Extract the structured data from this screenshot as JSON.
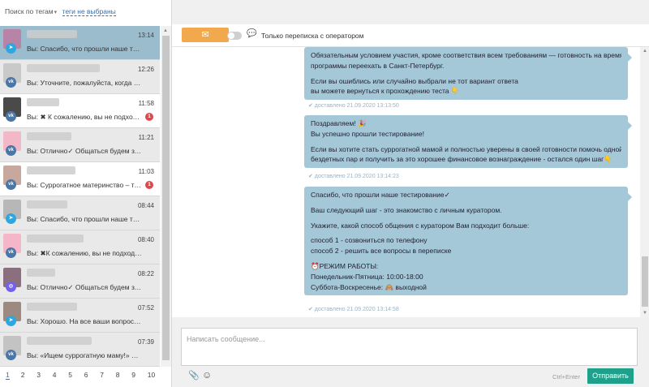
{
  "filter": {
    "label": "Поиск по тегам",
    "caret": "▾",
    "tags_link": "теги не выбраны"
  },
  "conversations": [
    {
      "time": "13:14",
      "preview": "Вы: Спасибо, что прошли наше тестов...",
      "network": "tg",
      "net_glyph": "➤",
      "state": "active",
      "avatar_color": "#b784a7",
      "badge": ""
    },
    {
      "time": "12:26",
      "preview": "Вы: Уточните, пожалуйста, когда ва...",
      "network": "vk",
      "net_glyph": "vk",
      "state": "normal",
      "avatar_color": "#c9c9c9",
      "badge": ""
    },
    {
      "time": "11:58",
      "preview": "Вы: ✖ К сожалению, вы не подходите...",
      "network": "vk",
      "net_glyph": "vk",
      "state": "white",
      "avatar_color": "#4a4a4a",
      "badge": "1"
    },
    {
      "time": "11:21",
      "preview": "Вы: Отлично✓ Общаться будем здес...",
      "network": "vk",
      "net_glyph": "vk",
      "state": "normal",
      "avatar_color": "#f2b8c8",
      "badge": ""
    },
    {
      "time": "11:03",
      "preview": "Вы: Суррогатное материнство – тяж...",
      "network": "vk",
      "net_glyph": "vk",
      "state": "white",
      "avatar_color": "#c8a89c",
      "badge": "1"
    },
    {
      "time": "08:44",
      "preview": "Вы: Спасибо, что прошли наше тест...",
      "network": "tg",
      "net_glyph": "➤",
      "state": "normal",
      "avatar_color": "#b7b7b7",
      "badge": ""
    },
    {
      "time": "08:40",
      "preview": "Вы: ✖К сожалению, вы не подходите...",
      "network": "vk",
      "net_glyph": "vk",
      "state": "normal",
      "avatar_color": "#f4b6c8",
      "badge": ""
    },
    {
      "time": "08:22",
      "preview": "Вы: Отлично✓ Общаться будем здес...",
      "network": "vb",
      "net_glyph": "◎",
      "state": "normal",
      "avatar_color": "#8a6f7e",
      "badge": ""
    },
    {
      "time": "07:52",
      "preview": "Вы: Хорошо. На все ваши вопросы п...",
      "network": "tg",
      "net_glyph": "➤",
      "state": "normal",
      "avatar_color": "#9c8a80",
      "badge": ""
    },
    {
      "time": "07:39",
      "preview": "Вы: «Ищем суррогатную маму!» Если...",
      "network": "vk",
      "net_glyph": "vk",
      "state": "normal",
      "avatar_color": "#c3c3c3",
      "badge": ""
    }
  ],
  "pagination": [
    "1",
    "2",
    "3",
    "4",
    "5",
    "6",
    "7",
    "8",
    "9",
    "10"
  ],
  "topbar": {
    "mail_icon": "✉",
    "toggle_label": "Только переписка с оператором",
    "chat_icon": "💬"
  },
  "messages": [
    {
      "lines": [
        "Обязательным условием участия, кроме соответствия всем требованиям — готовность на время",
        "программы переехать в Санкт-Петербург.",
        "",
        "Если вы ошиблись или случайно выбрали не тот вариант ответа",
        "вы можете вернуться к прохождению теста 👇"
      ],
      "status": "✔ доставлено 21.09.2020 13:13:50"
    },
    {
      "lines": [
        "Поздравляем! 🎉",
        "Вы успешно прошли тестирование!",
        "",
        "Если вы хотите стать суррогатной мамой и полностью уверены в своей готовности помочь одной из",
        "бездетных пар и получить за это хорошее финансовое вознаграждение - остался один шаг👇"
      ],
      "status": "✔ доставлено 21.09.2020 13:14:23"
    },
    {
      "lines": [
        "Спасибо, что прошли наше тестирование✓",
        "",
        "Ваш следующий шаг - это знакомство с личным куратором.",
        "",
        "Укажите, какой способ общения с куратором Вам подходит больше:",
        "",
        "способ 1 - созвониться по телефону",
        "способ 2 - решить все вопросы в переписке",
        "",
        "⏰РЕЖИМ РАБОТЫ:",
        "Понедельник-Пятница: 10:00-18:00",
        "Суббота-Воскресенье: 🙈 выходной"
      ],
      "status": "✔ доставлено 21.09.2020 13:14:58"
    }
  ],
  "composer": {
    "placeholder": "Написать сообщение...",
    "clip_icon": "📎",
    "smile_icon": "☺",
    "hint": "Ctrl+Enter",
    "send_label": "Отправить"
  },
  "colors": {
    "active_row": "#9bbccc",
    "bubble": "#a4c8d8",
    "send": "#1fa08a",
    "mail": "#f2a84c",
    "badge": "#e0474c"
  }
}
